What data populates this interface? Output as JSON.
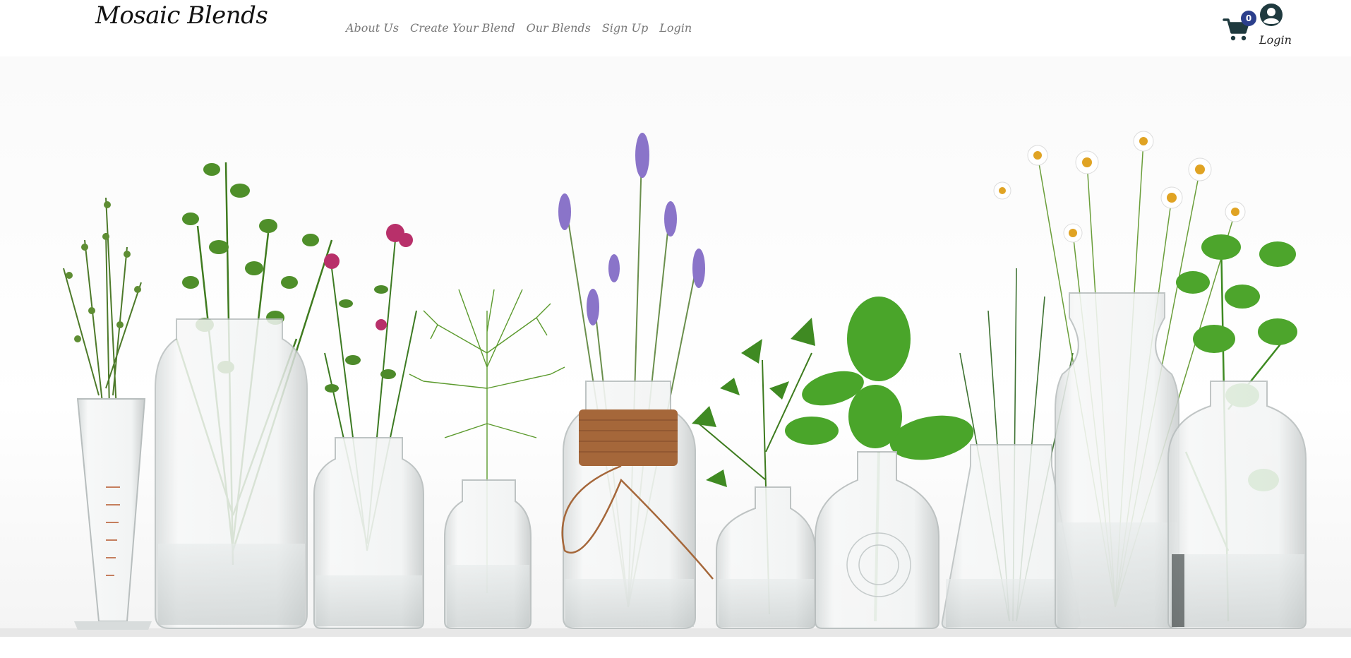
{
  "brand": {
    "name": "Mosaic Blends"
  },
  "nav": {
    "links": [
      "About Us",
      "Create Your Blend",
      "Our Blends",
      "Sign Up",
      "Login"
    ]
  },
  "cart": {
    "count": "0",
    "icon": "shopping-cart-icon"
  },
  "account": {
    "icon": "user-circle-icon",
    "label": "Login"
  },
  "hero": {
    "image": "herbs-in-glass-bottles"
  },
  "colors": {
    "brand_text": "#111111",
    "nav_text": "#777777",
    "badge_bg": "#2b3f8c",
    "icon": "#1f3a3f"
  }
}
